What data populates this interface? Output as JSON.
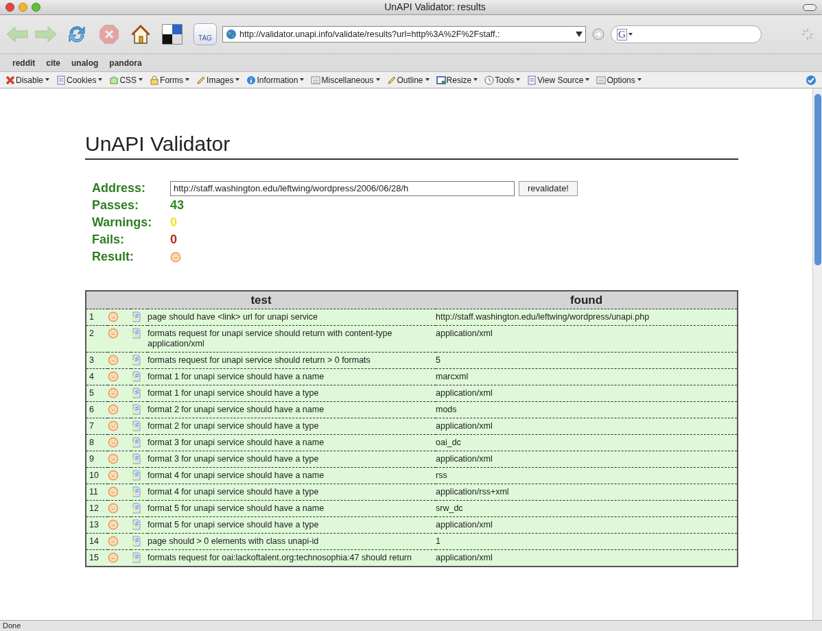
{
  "window": {
    "title": "UnAPI Validator: results"
  },
  "nav_buttons": [
    {
      "kind": "back",
      "disabled": true
    },
    {
      "kind": "forward",
      "disabled": true
    },
    {
      "kind": "reload",
      "disabled": false
    },
    {
      "kind": "stop",
      "disabled": true
    },
    {
      "kind": "home",
      "disabled": false
    },
    {
      "kind": "grid",
      "disabled": false
    },
    {
      "kind": "tag",
      "label": "TAG",
      "disabled": false
    }
  ],
  "address_bar": {
    "value": "http://validator.unapi.info/validate/results?url=http%3A%2F%2Fstaff.:"
  },
  "search": {
    "engine_letter": "G"
  },
  "bookmarks": [
    "reddit",
    "cite",
    "unalog",
    "pandora"
  ],
  "dev_toolbar": [
    {
      "label": "Disable",
      "kind": "cross"
    },
    {
      "label": "Cookies",
      "kind": "page"
    },
    {
      "label": "CSS",
      "kind": "puzzle"
    },
    {
      "label": "Forms",
      "kind": "lock"
    },
    {
      "label": "Images",
      "kind": "pencil"
    },
    {
      "label": "Information",
      "kind": "info"
    },
    {
      "label": "Miscellaneous",
      "kind": "list"
    },
    {
      "label": "Outline",
      "kind": "pencil"
    },
    {
      "label": "Resize",
      "kind": "window"
    },
    {
      "label": "Tools",
      "kind": "clock"
    },
    {
      "label": "View Source",
      "kind": "page"
    },
    {
      "label": "Options",
      "kind": "list"
    }
  ],
  "page": {
    "heading": "UnAPI Validator",
    "summary": [
      {
        "kind": "address",
        "label": "Address:",
        "value": "http://staff.washington.edu/leftwing/wordpress/2006/06/28/h",
        "button": "revalidate!"
      },
      {
        "kind": "count",
        "label": "Passes:",
        "value": "43",
        "color": "#2e8b1e"
      },
      {
        "kind": "count",
        "label": "Warnings:",
        "value": "0",
        "color": "#f2e22a"
      },
      {
        "kind": "count",
        "label": "Fails:",
        "value": "0",
        "color": "#b22a1a"
      },
      {
        "kind": "result",
        "label": "Result:",
        "passed": true
      }
    ],
    "table": {
      "columns": [
        "test",
        "found"
      ],
      "rows": [
        {
          "number": "1",
          "passed": true,
          "test": "page should have <link> url for unapi service",
          "found": "http://staff.washington.edu/leftwing/wordpress/unapi.php"
        },
        {
          "number": "2",
          "passed": true,
          "test": "formats request for unapi service should return with content-type application/xml",
          "found": "application/xml"
        },
        {
          "number": "3",
          "passed": true,
          "test": "formats request for unapi service should return > 0 formats",
          "found": "5"
        },
        {
          "number": "4",
          "passed": true,
          "test": "format 1 for unapi service should have a name",
          "found": "marcxml"
        },
        {
          "number": "5",
          "passed": true,
          "test": "format 1 for unapi service should have a type",
          "found": "application/xml"
        },
        {
          "number": "6",
          "passed": true,
          "test": "format 2 for unapi service should have a name",
          "found": "mods"
        },
        {
          "number": "7",
          "passed": true,
          "test": "format 2 for unapi service should have a type",
          "found": "application/xml"
        },
        {
          "number": "8",
          "passed": true,
          "test": "format 3 for unapi service should have a name",
          "found": "oai_dc"
        },
        {
          "number": "9",
          "passed": true,
          "test": "format 3 for unapi service should have a type",
          "found": "application/xml"
        },
        {
          "number": "10",
          "passed": true,
          "test": "format 4 for unapi service should have a name",
          "found": "rss"
        },
        {
          "number": "11",
          "passed": true,
          "test": "format 4 for unapi service should have a type",
          "found": "application/rss+xml"
        },
        {
          "number": "12",
          "passed": true,
          "test": "format 5 for unapi service should have a name",
          "found": "srw_dc"
        },
        {
          "number": "13",
          "passed": true,
          "test": "format 5 for unapi service should have a type",
          "found": "application/xml"
        },
        {
          "number": "14",
          "passed": true,
          "test": "page should > 0 elements with class unapi-id",
          "found": "1"
        },
        {
          "number": "15",
          "passed": true,
          "test": "formats request for oai:lackoftalent.org:technosophia:47 should return",
          "found": "application/xml"
        }
      ]
    }
  },
  "status_bar": {
    "text": "Done"
  }
}
